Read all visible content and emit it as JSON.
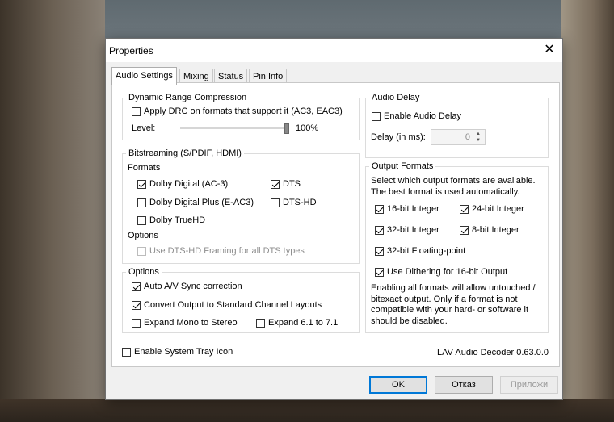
{
  "window": {
    "title": "Properties",
    "close_glyph": "✕"
  },
  "tabs": [
    {
      "label": "Audio Settings",
      "active": true
    },
    {
      "label": "Mixing",
      "active": false
    },
    {
      "label": "Status",
      "active": false
    },
    {
      "label": "Pin Info",
      "active": false
    }
  ],
  "drc": {
    "title": "Dynamic Range Compression",
    "apply_label": "Apply DRC on formats that support it (AC3, EAC3)",
    "apply_checked": false,
    "level_label": "Level:",
    "level_value": "100%",
    "level_fraction": 1.0
  },
  "bitstreaming": {
    "title": "Bitstreaming (S/PDIF, HDMI)",
    "formats_label": "Formats",
    "dolby_digital": {
      "label": "Dolby Digital (AC-3)",
      "checked": true
    },
    "dts": {
      "label": "DTS",
      "checked": true
    },
    "dolby_digital_plus": {
      "label": "Dolby Digital Plus (E-AC3)",
      "checked": false
    },
    "dts_hd": {
      "label": "DTS-HD",
      "checked": false
    },
    "dolby_truehd": {
      "label": "Dolby TrueHD",
      "checked": false
    },
    "options_label": "Options",
    "dts_hd_framing": {
      "label": "Use DTS-HD Framing for all DTS types",
      "checked": false,
      "disabled": true
    }
  },
  "options": {
    "title": "Options",
    "auto_av_sync": {
      "label": "Auto A/V Sync correction",
      "checked": true
    },
    "convert_output": {
      "label": "Convert Output to Standard Channel Layouts",
      "checked": true
    },
    "expand_mono": {
      "label": "Expand Mono to Stereo",
      "checked": false
    },
    "expand_61": {
      "label": "Expand 6.1 to 7.1",
      "checked": false
    }
  },
  "audio_delay": {
    "title": "Audio Delay",
    "enable_label": "Enable Audio Delay",
    "enable_checked": false,
    "delay_label": "Delay (in ms):",
    "delay_value": "0"
  },
  "output_formats": {
    "title": "Output Formats",
    "description": "Select which output formats are available. The best format is used automatically.",
    "int16": {
      "label": "16-bit Integer",
      "checked": true
    },
    "int24": {
      "label": "24-bit Integer",
      "checked": true
    },
    "int32": {
      "label": "32-bit Integer",
      "checked": true
    },
    "int8": {
      "label": "8-bit Integer",
      "checked": true
    },
    "float32": {
      "label": "32-bit Floating-point",
      "checked": true
    },
    "dithering": {
      "label": "Use Dithering for 16-bit Output",
      "checked": true
    },
    "note": "Enabling all formats will allow untouched / bitexact output. Only if a format is not compatible with your hard- or software it should be disabled."
  },
  "tray_icon": {
    "label": "Enable System Tray Icon",
    "checked": false
  },
  "version": "LAV Audio Decoder 0.63.0.0",
  "buttons": {
    "ok": "OK",
    "cancel": "Отказ",
    "apply": "Приложи"
  }
}
